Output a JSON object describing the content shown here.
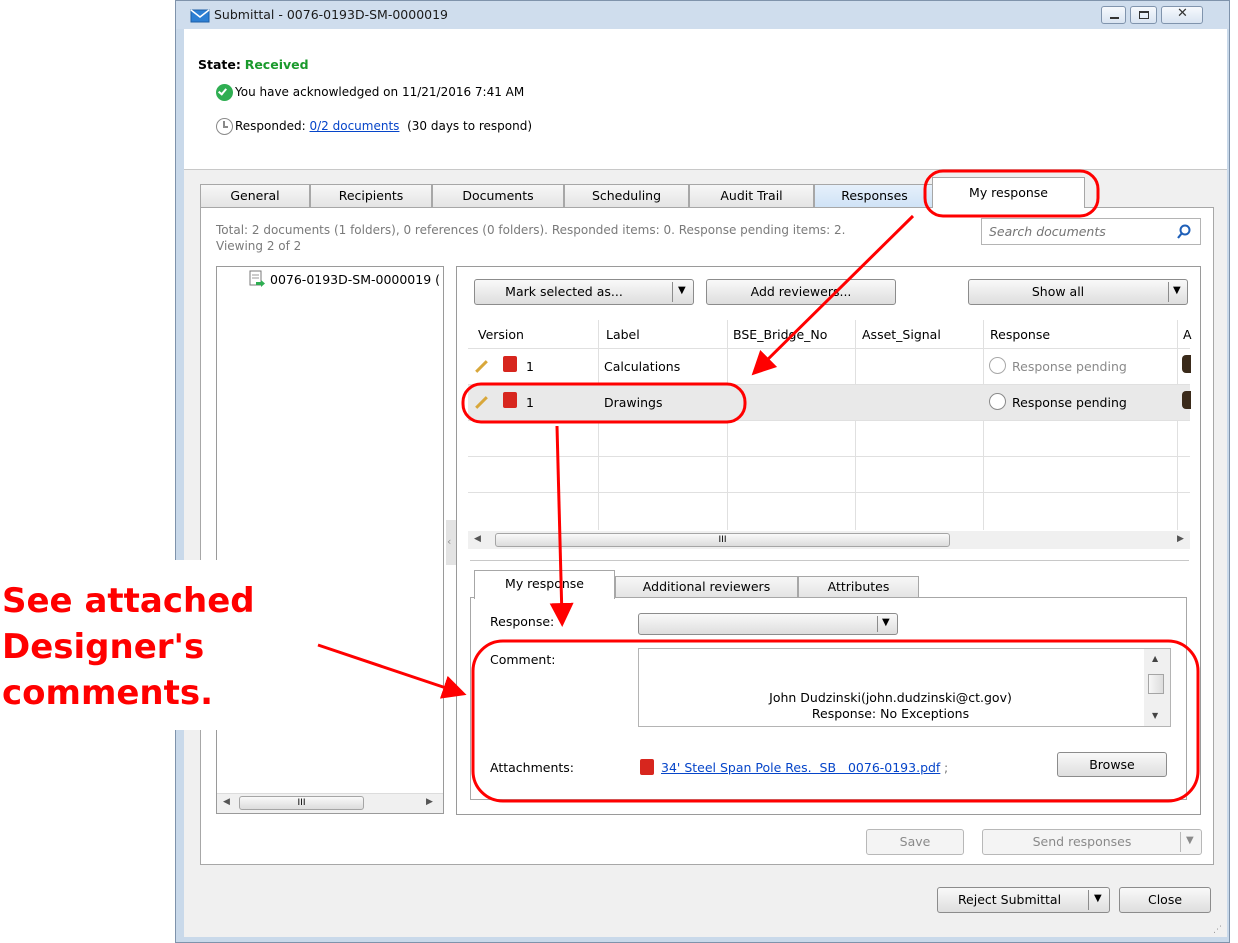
{
  "window": {
    "title": "Submittal - 0076-0193D-SM-0000019"
  },
  "status": {
    "state_label": "State:",
    "state_value": "Received",
    "acknowledged": "You have acknowledged on 11/21/2016 7:41 AM",
    "responded_label": "Responded:",
    "responded_link": "0/2 documents",
    "responded_note": "(30 days to respond)"
  },
  "tabs": [
    "General",
    "Recipients",
    "Documents",
    "Scheduling",
    "Audit Trail",
    "Responses",
    "My response"
  ],
  "summary": {
    "line1": "Total: 2 documents (1 folders), 0 references (0 folders). Responded items: 0. Response pending items: 2.",
    "line2": "Viewing 2 of 2"
  },
  "search": {
    "placeholder": "Search documents"
  },
  "tree": {
    "item": "0076-0193D-SM-0000019 ("
  },
  "toolbar": {
    "mark_selected": "Mark selected as...",
    "add_reviewers": "Add reviewers...",
    "show_all": "Show all"
  },
  "grid": {
    "columns": [
      "Version",
      "Label",
      "BSE_Bridge_No",
      "Asset_Signal",
      "Response",
      "A"
    ],
    "rows": [
      {
        "version": "1",
        "label": "Calculations",
        "response": "Response pending"
      },
      {
        "version": "1",
        "label": "Drawings",
        "response": "Response pending"
      }
    ],
    "scroll_glyph": "III"
  },
  "subtabs": [
    "My response",
    "Additional reviewers",
    "Attributes"
  ],
  "response_form": {
    "response_label": "Response:",
    "comment_label": "Comment:",
    "comment_line1": "John Dudzinski(john.dudzinski@ct.gov)",
    "comment_line2": "Response: No Exceptions",
    "attachments_label": "Attachments:",
    "attachment_file": "34' Steel Span Pole Res.  SB   0076-0193.pdf",
    "attachment_sep": ";",
    "browse": "Browse"
  },
  "actions": {
    "save": "Save",
    "send_responses": "Send responses",
    "reject_submittal": "Reject Submittal",
    "close": "Close"
  },
  "annotation": {
    "line1": "See attached",
    "line2": "Designer's",
    "line3": "comments."
  },
  "colors": {
    "state_green": "#1a9a2c",
    "annotation_red": "#ff0000",
    "link_blue": "#0645c9"
  }
}
